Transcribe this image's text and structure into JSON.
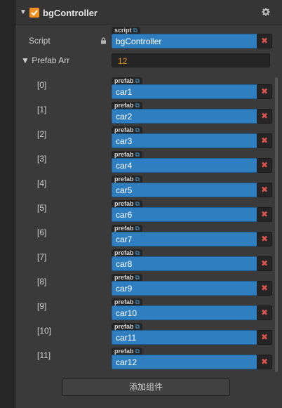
{
  "component": {
    "title": "bgController",
    "enabled": true
  },
  "script_row": {
    "label": "Script",
    "tag": "script",
    "value": "bgController",
    "clear": "✖"
  },
  "prefab_arr": {
    "label": "Prefab Arr",
    "count": "12",
    "tag": "prefab",
    "clear": "✖",
    "items": [
      {
        "index": "[0]",
        "value": "car1"
      },
      {
        "index": "[1]",
        "value": "car2"
      },
      {
        "index": "[2]",
        "value": "car3"
      },
      {
        "index": "[3]",
        "value": "car4"
      },
      {
        "index": "[4]",
        "value": "car5"
      },
      {
        "index": "[5]",
        "value": "car6"
      },
      {
        "index": "[6]",
        "value": "car7"
      },
      {
        "index": "[7]",
        "value": "car8"
      },
      {
        "index": "[8]",
        "value": "car9"
      },
      {
        "index": "[9]",
        "value": "car10"
      },
      {
        "index": "[10]",
        "value": "car11"
      },
      {
        "index": "[11]",
        "value": "car12"
      }
    ]
  },
  "add_component_label": "添加组件",
  "colors": {
    "accent": "#f0901e",
    "field_blue": "#2f7fc0",
    "clear_red": "#d9534f"
  }
}
